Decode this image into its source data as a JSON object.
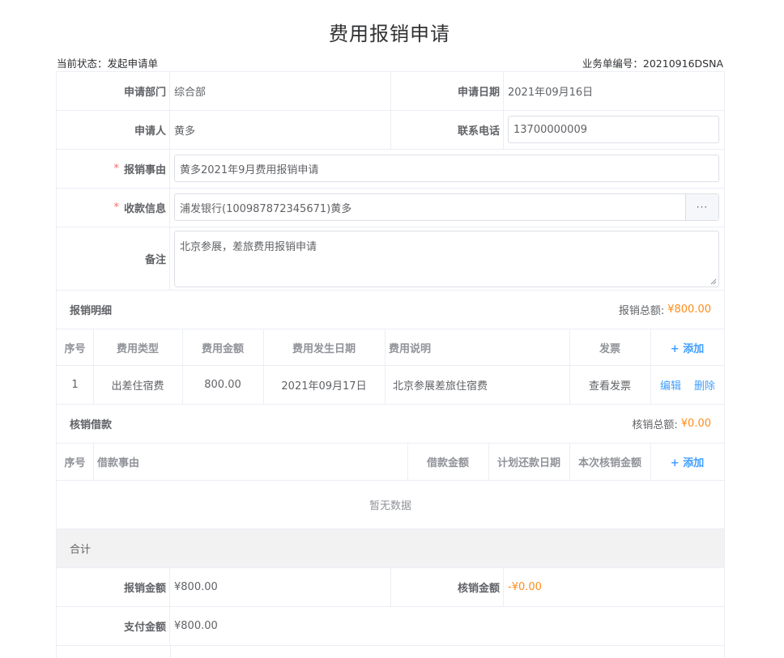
{
  "page": {
    "title": "费用报销申请",
    "status_text": "当前状态：发起申请单",
    "doc_no_text": "业务单编号：20210916DSNA"
  },
  "form": {
    "dept_label": "申请部门",
    "dept_value": "综合部",
    "date_label": "申请日期",
    "date_value": "2021年09月16日",
    "applicant_label": "申请人",
    "applicant_value": "黄多",
    "phone_label": "联系电话",
    "phone_value": "13700000009",
    "reason_label": "报销事由",
    "reason_value": "黄多2021年9月费用报销申请",
    "payee_label": "收款信息",
    "payee_value": "浦发银行(100987872345671)黄多",
    "payee_more": "···",
    "remark_label": "备注",
    "remark_value": "北京参展，差旅费用报销申请",
    "required_mark": "*"
  },
  "detail": {
    "title": "报销明细",
    "total_label": "报销总额:",
    "total_value": "¥800.00",
    "headers": [
      "序号",
      "费用类型",
      "费用金额",
      "费用发生日期",
      "费用说明",
      "发票"
    ],
    "add_label": "+ 添加",
    "rows": [
      {
        "no": "1",
        "type": "出差住宿费",
        "amount": "800.00",
        "date": "2021年09月17日",
        "desc": "北京参展差旅住宿费",
        "invoice": "查看发票",
        "edit": "编辑",
        "delete": "删除"
      }
    ]
  },
  "loan": {
    "title": "核销借款",
    "total_label": "核销总额:",
    "total_value": "¥0.00",
    "headers": [
      "序号",
      "借款事由",
      "借款金额",
      "计划还款日期",
      "本次核销金额"
    ],
    "add_label": "+ 添加",
    "empty_text": "暂无数据"
  },
  "summary": {
    "title": "合计",
    "reimburse_label": "报销金额",
    "reimburse_value": "¥800.00",
    "writeoff_label": "核销金额",
    "writeoff_value": "-¥0.00",
    "pay_label": "支付金额",
    "pay_value": "¥800.00"
  },
  "colors": {
    "accent": "#409eff",
    "amount": "#ff8c1a",
    "required": "#f56c6c",
    "border": "#ebeef5"
  }
}
